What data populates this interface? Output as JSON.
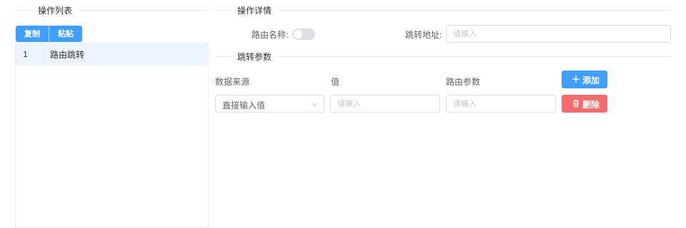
{
  "left": {
    "section_title": "操作列表",
    "copy_label": "复制",
    "paste_label": "粘贴",
    "items": [
      {
        "index": "1",
        "label": "路由跳转"
      }
    ]
  },
  "right": {
    "section_title": "操作详情",
    "route_name_label": "路由名称:",
    "route_name_enabled": false,
    "jump_address_label": "跳转地址:",
    "jump_address_placeholder": "请输入",
    "params_section_title": "跳转参数",
    "columns": [
      "数据来源",
      "值",
      "路由参数"
    ],
    "add_label": "添加",
    "delete_label": "删除",
    "row": {
      "source_value": "直接输入值",
      "value_placeholder": "请输入",
      "param_placeholder": "请输入"
    }
  },
  "colors": {
    "primary": "#409eff",
    "danger": "#f56c6c",
    "selected_row": "#ecf5ff"
  }
}
